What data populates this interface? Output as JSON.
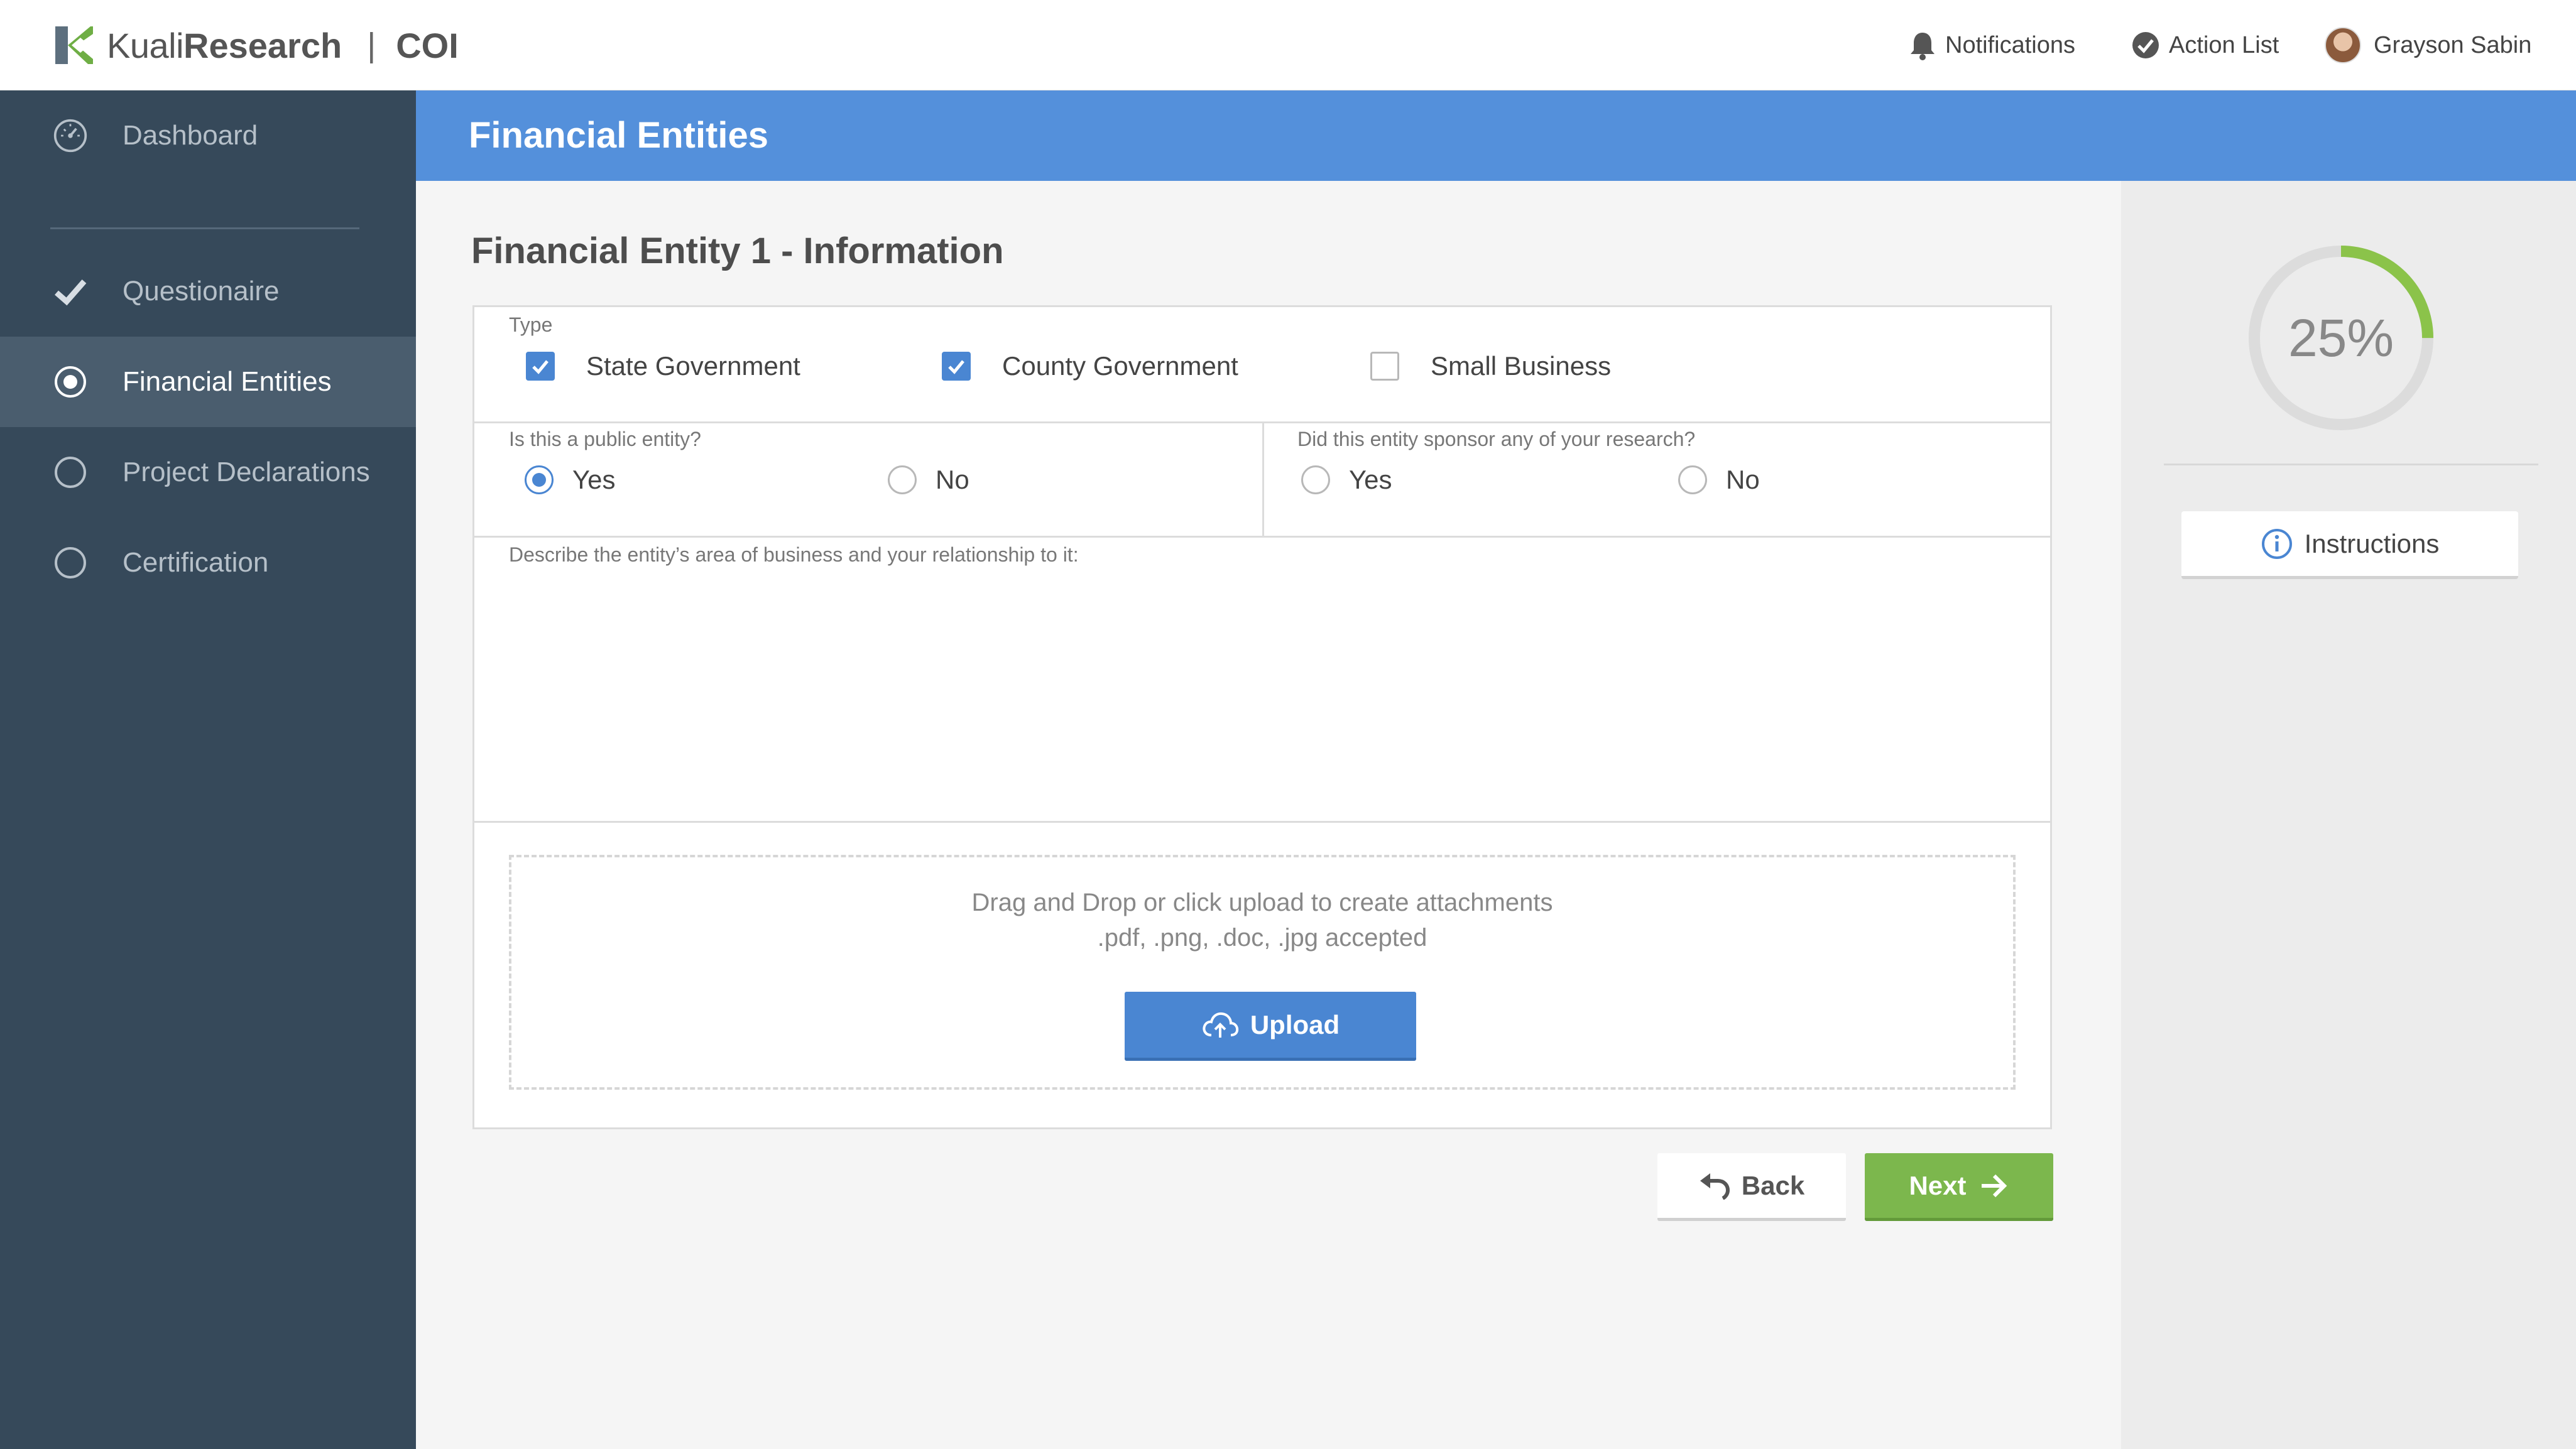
{
  "header": {
    "brand_kuali": "Kuali",
    "brand_research": "Research",
    "brand_separator": "|",
    "brand_module": "COI",
    "notifications_label": "Notifications",
    "action_list_label": "Action List",
    "user_name": "Grayson Sabin"
  },
  "sidebar": {
    "items": [
      {
        "label": "Dashboard",
        "icon": "dashboard-icon"
      },
      {
        "label": "Questionaire",
        "icon": "checkmark-icon"
      },
      {
        "label": "Financial Entities",
        "icon": "radio-selected-icon",
        "active": true
      },
      {
        "label": "Project Declarations",
        "icon": "radio-empty-icon"
      },
      {
        "label": "Certification",
        "icon": "radio-empty-icon"
      }
    ]
  },
  "page": {
    "title": "Financial Entities",
    "section_title": "Financial Entity 1 - Information"
  },
  "form": {
    "type_label": "Type",
    "type_options": [
      {
        "label": "State Government",
        "checked": true
      },
      {
        "label": "County Government",
        "checked": true
      },
      {
        "label": "Small Business",
        "checked": false
      }
    ],
    "public_entity": {
      "question": "Is this a public entity?",
      "yes_label": "Yes",
      "no_label": "No",
      "selected": "Yes"
    },
    "sponsor": {
      "question": "Did this entity sponsor any of your research?",
      "yes_label": "Yes",
      "no_label": "No",
      "selected": ""
    },
    "description_label": "Describe the entity’s area of business and your relationship to it:",
    "description_value": "",
    "dropzone_line1": "Drag and Drop or click upload to create attachments",
    "dropzone_line2": ".pdf, .png, .doc, .jpg accepted",
    "upload_label": "Upload"
  },
  "nav_buttons": {
    "back_label": "Back",
    "next_label": "Next"
  },
  "progress": {
    "percent_label": "25%",
    "fraction": 0.25,
    "color": "#8bc34a"
  },
  "right_panel": {
    "instructions_label": "Instructions"
  },
  "colors": {
    "primary_blue": "#5490db",
    "sidebar_bg": "#36495a",
    "accent_green": "#7cb74d"
  }
}
